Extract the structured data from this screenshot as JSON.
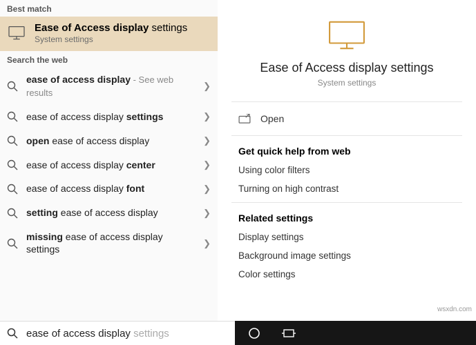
{
  "labels": {
    "best_match": "Best match",
    "search_web": "Search the web"
  },
  "best_match": {
    "title_bold": "Ease of Access display",
    "title_tail": " settings",
    "subtitle": "System settings"
  },
  "web": [
    {
      "pre": "",
      "bold": "ease of access display",
      "post": "",
      "hint": " - See web results"
    },
    {
      "pre": "ease of access display ",
      "bold": "settings",
      "post": "",
      "hint": ""
    },
    {
      "pre": "",
      "bold": "open",
      "post": " ease of access display",
      "hint": ""
    },
    {
      "pre": "ease of access display ",
      "bold": "center",
      "post": "",
      "hint": ""
    },
    {
      "pre": "ease of access display ",
      "bold": "font",
      "post": "",
      "hint": ""
    },
    {
      "pre": "",
      "bold": "setting",
      "post": " ease of access display",
      "hint": ""
    },
    {
      "pre": "",
      "bold": "missing",
      "post": " ease of access display settings",
      "hint": ""
    }
  ],
  "hero": {
    "title": "Ease of Access display settings",
    "subtitle": "System settings",
    "open": "Open"
  },
  "quick": {
    "heading": "Get quick help from web",
    "items": [
      "Using color filters",
      "Turning on high contrast"
    ]
  },
  "related": {
    "heading": "Related settings",
    "items": [
      "Display settings",
      "Background image settings",
      "Color settings"
    ]
  },
  "search": {
    "typed": "ease of access display ",
    "completion": "settings"
  },
  "watermark": "wsxdn.com"
}
